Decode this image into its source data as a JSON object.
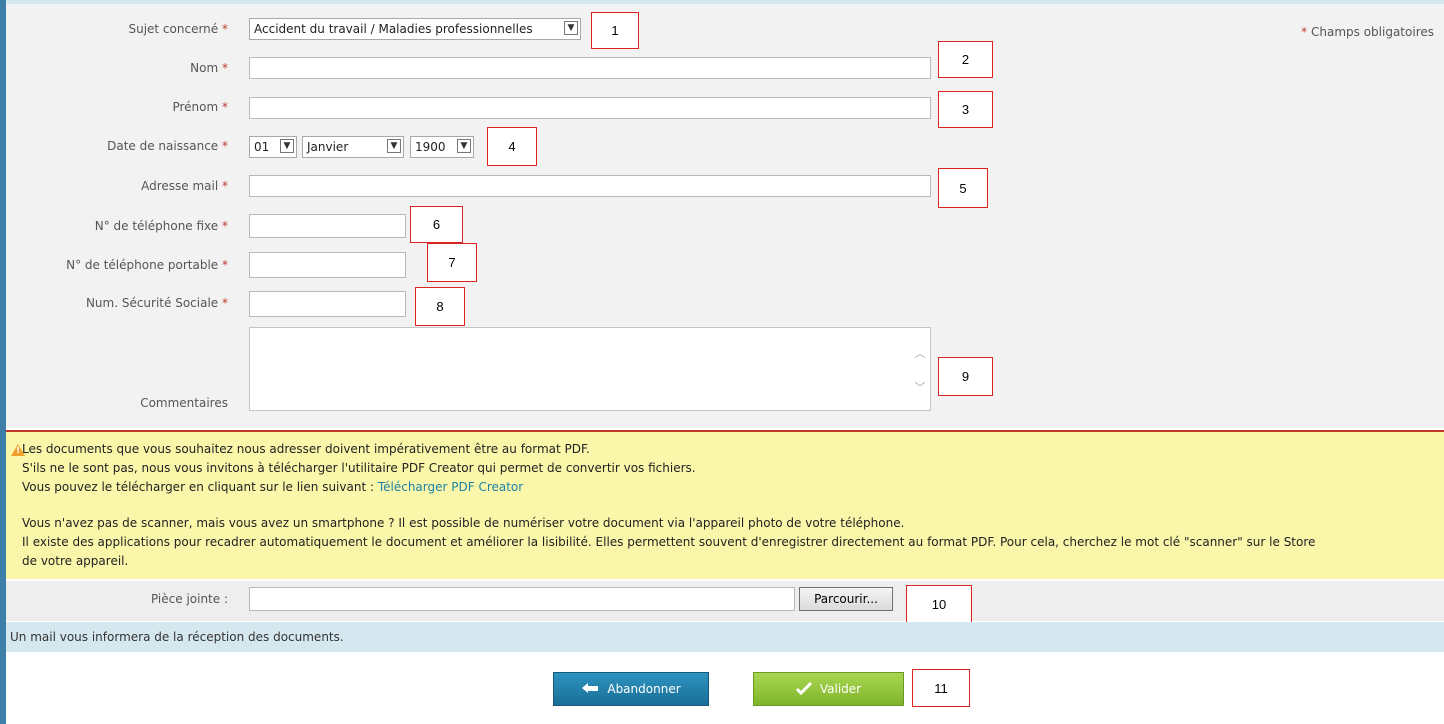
{
  "form": {
    "required_note": "Champs obligatoires",
    "required_mark": "*",
    "fields": [
      {
        "label": "Sujet concerné"
      },
      {
        "label": "Nom"
      },
      {
        "label": "Prénom"
      },
      {
        "label": "Date de naissance"
      },
      {
        "label": "Adresse mail"
      },
      {
        "label": "N° de téléphone fixe"
      },
      {
        "label": "N° de téléphone portable"
      },
      {
        "label": "Num. Sécurité Sociale"
      },
      {
        "label": "Commentaires"
      }
    ],
    "subject_value": "Accident du travail / Maladies professionnelles",
    "birth_day": "01",
    "birth_month": "Janvier",
    "birth_year": "1900"
  },
  "callouts": [
    "1",
    "2",
    "3",
    "4",
    "5",
    "6",
    "7",
    "8",
    "9",
    "10",
    "11"
  ],
  "notice": {
    "line1": "Les documents que vous souhaitez nous adresser doivent impérativement être au format PDF.",
    "line2": "S'ils ne le sont pas, nous vous invitons à télécharger l'utilitaire PDF Creator qui permet de convertir vos fichiers.",
    "line3_prefix": "Vous pouvez le télécharger en cliquant sur le lien suivant : ",
    "link_text": "Télécharger PDF Creator",
    "line4": "Vous n'avez pas de scanner, mais vous avez un smartphone ? Il est possible de numériser votre document via l'appareil photo de votre téléphone.",
    "line5": "Il existe des applications pour recadrer automatiquement le document et améliorer la lisibilité. Elles permettent souvent d'enregistrer directement au format PDF. Pour cela, cherchez le mot clé \"scanner\" sur le Store",
    "line6": "de votre appareil."
  },
  "attachment": {
    "label": "Pièce jointe :",
    "browse_label": "Parcourir..."
  },
  "mail_info": "Un mail vous informera de la réception des documents.",
  "buttons": {
    "cancel": "Abandonner",
    "submit": "Valider"
  }
}
